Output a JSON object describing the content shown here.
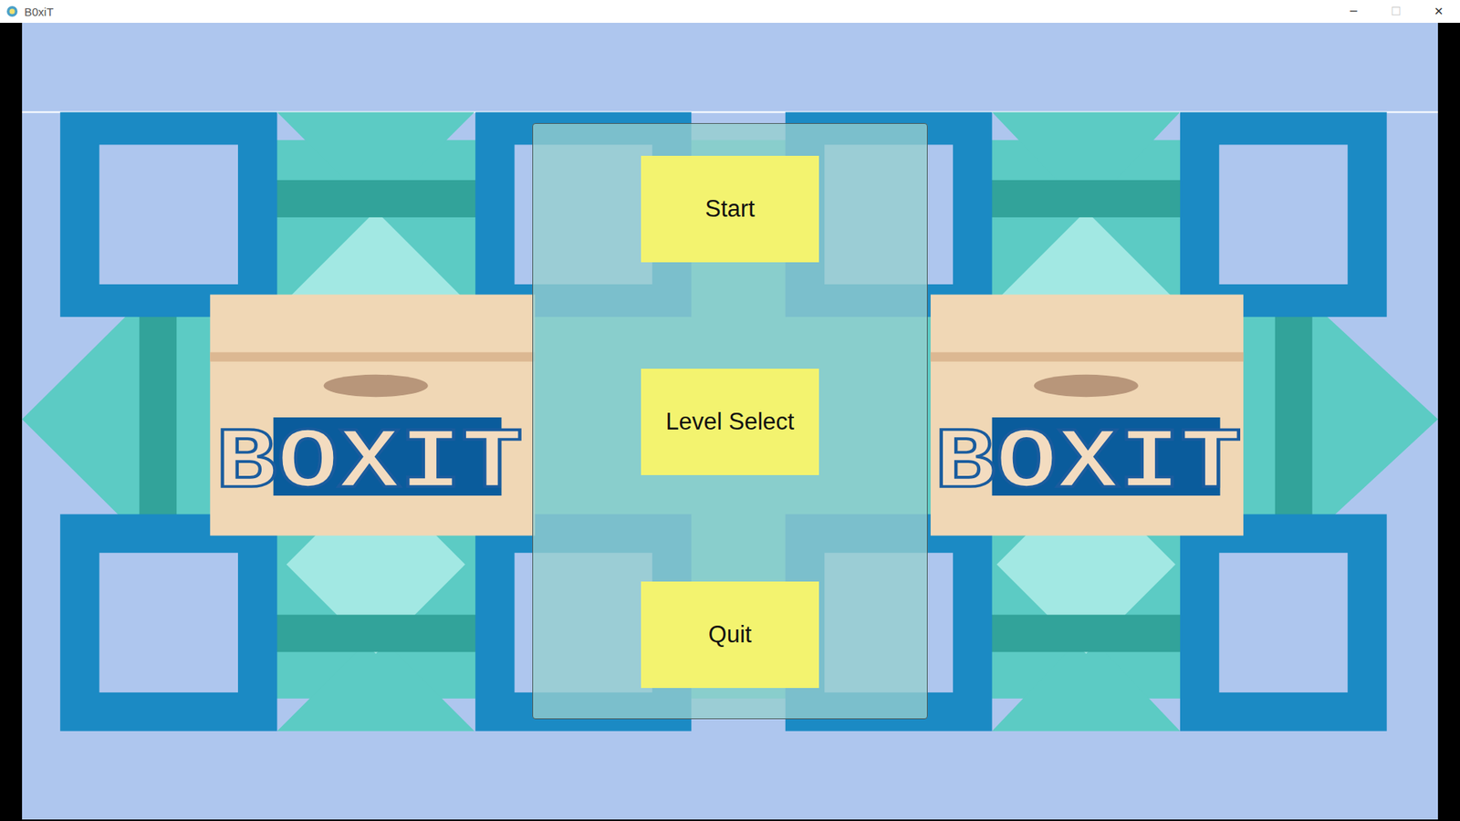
{
  "window": {
    "title": "B0xiT",
    "controls": [
      {
        "glyph": "─",
        "disabled": false
      },
      {
        "glyph": "☐",
        "disabled": true
      },
      {
        "glyph": "✕",
        "disabled": false
      }
    ]
  },
  "logos": [
    "BOXIT",
    "BOXIT"
  ],
  "menu": {
    "buttons": [
      {
        "label": "Start"
      },
      {
        "label": "Level Select"
      },
      {
        "label": "Quit"
      }
    ]
  }
}
